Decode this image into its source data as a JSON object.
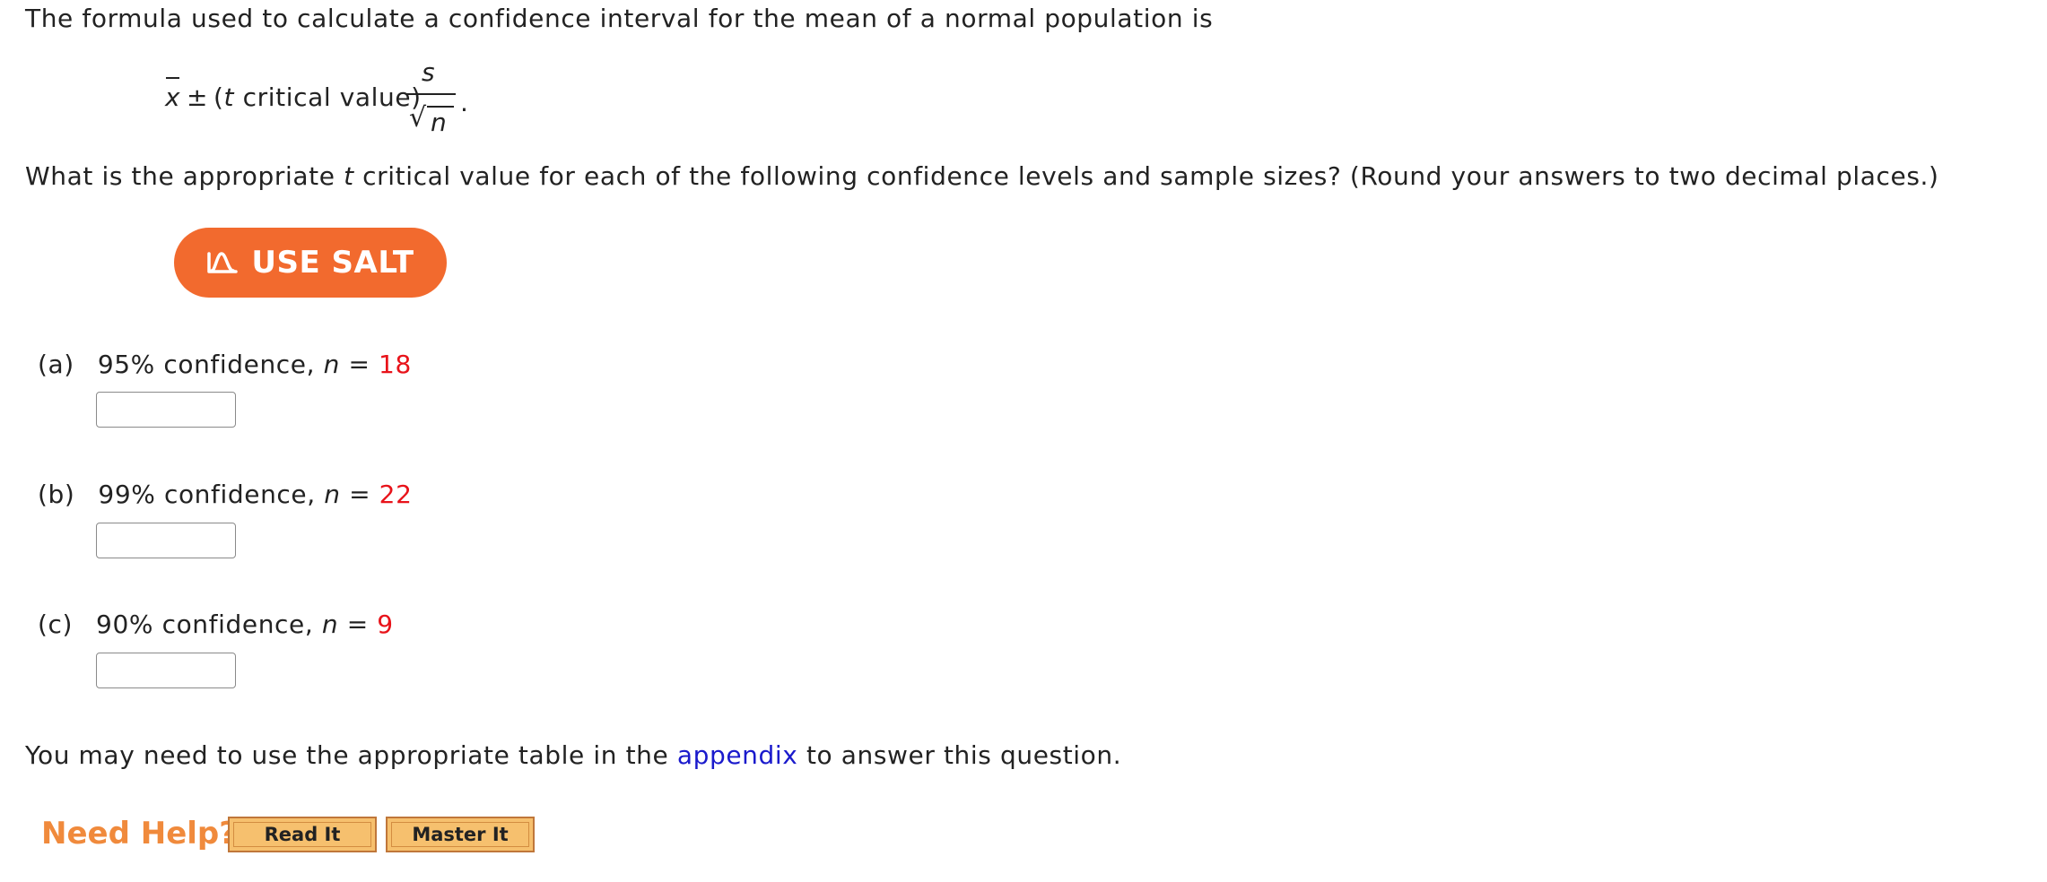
{
  "intro": {
    "text": "The formula used to calculate a confidence interval for the mean of a normal population is"
  },
  "formula": {
    "xbar": "x",
    "plus_minus": "±",
    "t_open": "(",
    "t_var": "t",
    "t_rest": " critical value)",
    "numerator": "s",
    "sqrt": "√",
    "denominator": "n",
    "period": "."
  },
  "question": {
    "before": "What is the appropriate ",
    "t_var": "t",
    "after": " critical value for each of the following confidence levels and sample sizes? (Round your answers to two decimal places.)"
  },
  "salt_button": {
    "label": "USE SALT",
    "color": "#f26a2e",
    "icon": "salt-curve-icon"
  },
  "parts": [
    {
      "label": "(a)",
      "text": "95% confidence, ",
      "n_var": "n",
      "eq": " = ",
      "n_value": "18",
      "answer": ""
    },
    {
      "label": "(b)",
      "text": "99% confidence, ",
      "n_var": "n",
      "eq": " = ",
      "n_value": "22",
      "answer": ""
    },
    {
      "label": "(c)",
      "text": "90% confidence, ",
      "n_var": "n",
      "eq": " = ",
      "n_value": "9",
      "answer": ""
    }
  ],
  "appendix_note": {
    "before": "You may need to use the appropriate table in the ",
    "link": "appendix",
    "after": " to answer this question."
  },
  "help": {
    "label": "Need Help?",
    "read_it": "Read It",
    "master_it": "Master It"
  },
  "colors": {
    "highlight_red": "#e8131a",
    "link_blue": "#1a1acc",
    "help_orange": "#f08a3c"
  }
}
